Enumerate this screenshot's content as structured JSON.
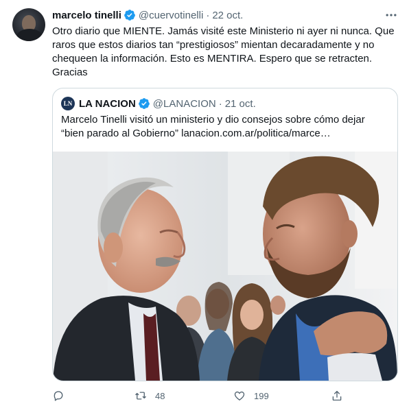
{
  "tweet": {
    "author_name": "marcelo tinelli",
    "handle": "@cuervotinelli",
    "separator": "·",
    "date": "22 oct.",
    "text_lines": [
      "Otro diario que MIENTE. Jamás visité este Ministerio ni ayer ni nunca. Que",
      "raros que estos  diarios tan “prestigiosos” mientan decaradamente y no",
      "chequeen la información. Esto es MENTIRA. Espero que se retracten.",
      "Gracias"
    ]
  },
  "quote": {
    "logo_text": "LN",
    "author_name": "LA NACION",
    "handle": "@LANACION",
    "separator": "·",
    "date": "21 oct.",
    "text_lines": [
      "Marcelo Tinelli visitó un ministerio y dio consejos sobre cómo dejar",
      "“bien parado al Gobierno” lanacion.com.ar/politica/marce…"
    ]
  },
  "actions": {
    "reply_count": "",
    "retweet_count": "48",
    "like_count": "199"
  },
  "icons": {
    "verified": "verified-badge-icon",
    "more": "more-icon",
    "reply": "reply-icon",
    "retweet": "retweet-icon",
    "like": "like-icon",
    "share": "share-icon"
  },
  "colors": {
    "text": "#0f1419",
    "muted": "#536471",
    "verified": "#1d9bf0",
    "border": "#cfd9de"
  }
}
